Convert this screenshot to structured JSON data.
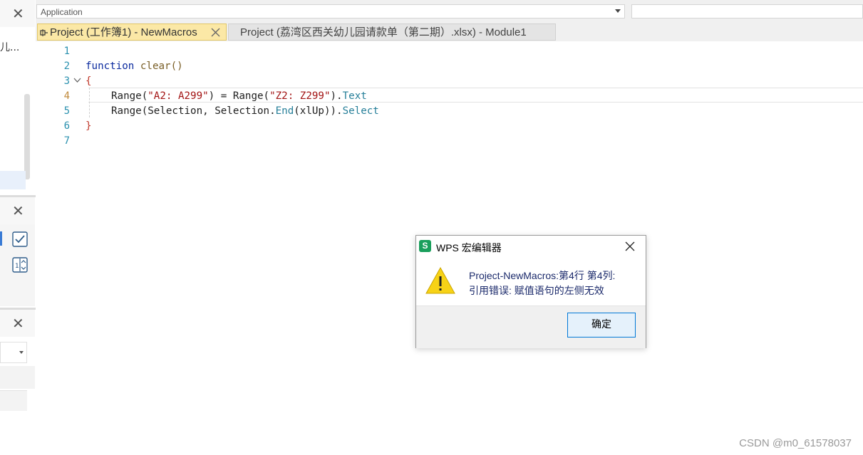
{
  "left_panels": {
    "top_text": "儿...",
    "close_glyph": "✕"
  },
  "toolbar": {
    "object_combo_value": "Application"
  },
  "tabs": [
    {
      "label": "Project (工作簿1) - NewMacros",
      "active": true
    },
    {
      "label": "Project (荔湾区西关幼儿园请款单（第二期）.xlsx) - Module1",
      "active": false
    }
  ],
  "editor": {
    "line_numbers": [
      "1",
      "2",
      "3",
      "4",
      "5",
      "6",
      "7"
    ],
    "current_line": "4",
    "code": {
      "l2_kw": "function",
      "l2_name": "clear()",
      "l3_brace": "{",
      "l4_a": "Range(",
      "l4_s1": "\"A2: A299\"",
      "l4_b": ") = Range(",
      "l4_s2": "\"Z2: Z299\"",
      "l4_c": ").",
      "l4_prop": "Text",
      "l5_a": "Range(Selection, Selection.",
      "l5_fn": "End",
      "l5_b": "(xlUp)).",
      "l5_prop": "Select",
      "l6_brace": "}"
    }
  },
  "dialog": {
    "title": "WPS 宏编辑器",
    "app_icon_letter": "S",
    "message_line1": "Project-NewMacros:第4行 第4列:",
    "message_line2": "引用错误: 赋值语句的左侧无效",
    "ok_label": "确定",
    "icon": "warning-icon"
  },
  "watermark": "CSDN @m0_61578037",
  "colors": {
    "active_tab": "#fbe8a6",
    "line_number": "#2b91af",
    "wps_green": "#1a9f5c",
    "warning_yellow": "#f7d216"
  }
}
